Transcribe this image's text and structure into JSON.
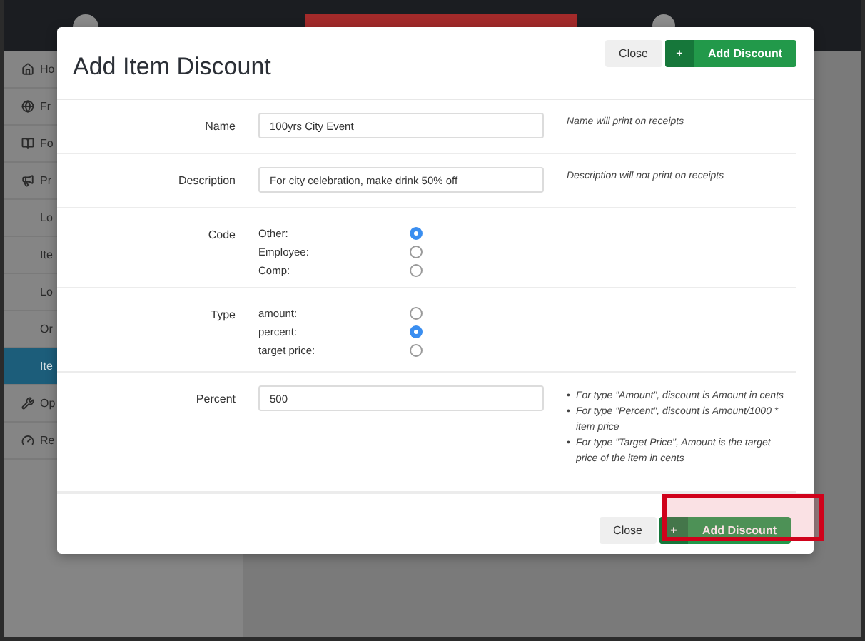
{
  "sidebar": {
    "items": [
      {
        "label": "Ho",
        "selected": false
      },
      {
        "label": "Fr",
        "selected": false
      },
      {
        "label": "Fo",
        "selected": false
      },
      {
        "label": "Pr",
        "selected": false,
        "children": [
          {
            "label": "Lo",
            "selected": false
          },
          {
            "label": "Ite",
            "selected": false
          },
          {
            "label": "Lo",
            "selected": false
          },
          {
            "label": "Or",
            "selected": false
          },
          {
            "label": "Ite",
            "selected": true
          }
        ]
      },
      {
        "label": "Op",
        "selected": false
      },
      {
        "label": "Re",
        "selected": false
      }
    ]
  },
  "modal": {
    "title": "Add Item Discount",
    "header_buttons": [
      {
        "kind": "secondary",
        "label": "Close"
      },
      {
        "kind": "primary",
        "icon": "+",
        "label": "Add Discount"
      }
    ],
    "fields": [
      {
        "kind": "text",
        "label": "Name",
        "value": "100yrs City Event",
        "help": "Name will print on receipts"
      },
      {
        "kind": "text",
        "label": "Description",
        "value": "For city celebration, make drink 50% off",
        "help": "Description will not print on receipts"
      },
      {
        "kind": "radio",
        "label": "Code",
        "options": [
          {
            "label": "Other:",
            "selected": true
          },
          {
            "label": "Employee:",
            "selected": false
          },
          {
            "label": "Comp:",
            "selected": false
          }
        ]
      },
      {
        "kind": "radio",
        "label": "Type",
        "options": [
          {
            "label": "amount:",
            "selected": false
          },
          {
            "label": "percent:",
            "selected": true
          },
          {
            "label": "target price:",
            "selected": false
          }
        ]
      },
      {
        "kind": "text",
        "label": "Percent",
        "value": "500",
        "help_list": [
          {
            "marker": "•",
            "text": "For type \"Amount\", discount is Amount in cents"
          },
          {
            "marker": "•",
            "text": "For type \"Percent\", discount is Amount/1000 * item price"
          },
          {
            "marker": "•",
            "text": "For type \"Target Price\", Amount is the target price of the item in cents"
          }
        ]
      }
    ],
    "footer_buttons": [
      {
        "kind": "secondary",
        "label": "Close"
      },
      {
        "kind": "primary",
        "icon": "+",
        "label": "Add Discount"
      }
    ]
  }
}
